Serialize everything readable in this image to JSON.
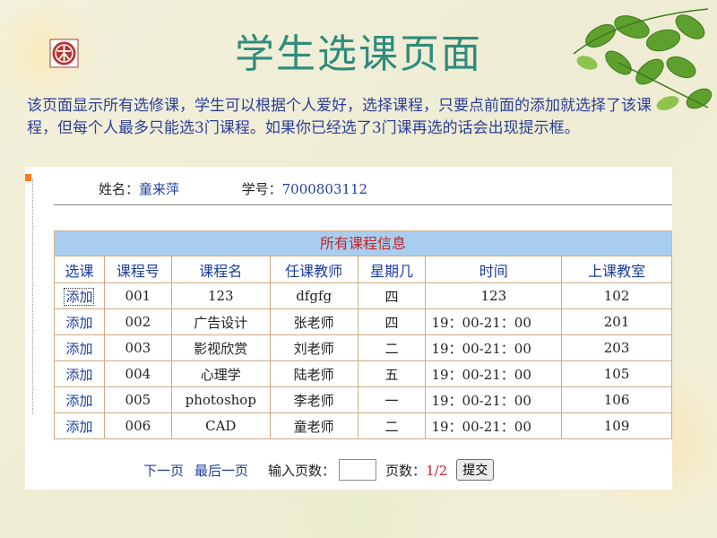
{
  "header": {
    "title": "学生选课页面"
  },
  "description": "该页面显示所有选修课，学生可以根据个人爱好，选择课程，只要点前面的添加就选择了该课程，但每个人最多只能选3门课程。如果你已经选了3门课再选的话会出现提示框。",
  "student": {
    "name_label": "姓名：",
    "name": "童来萍",
    "id_label": "学号：",
    "id": "7000803112"
  },
  "table": {
    "caption": "所有课程信息",
    "columns": [
      "选课",
      "课程号",
      "课程名",
      "任课教师",
      "星期几",
      "时间",
      "上课教室"
    ],
    "rows": [
      {
        "action": "添加",
        "code": "001",
        "name": "123",
        "teacher": "dfgfg",
        "weekday": "四",
        "time": "123",
        "room": "102"
      },
      {
        "action": "添加",
        "code": "002",
        "name": "广告设计",
        "teacher": "张老师",
        "weekday": "四",
        "time": "19：00-21：00",
        "room": "201"
      },
      {
        "action": "添加",
        "code": "003",
        "name": "影视欣赏",
        "teacher": "刘老师",
        "weekday": "二",
        "time": "19：00-21：00",
        "room": "203"
      },
      {
        "action": "添加",
        "code": "004",
        "name": "心理学",
        "teacher": "陆老师",
        "weekday": "五",
        "time": "19：00-21：00",
        "room": "105"
      },
      {
        "action": "添加",
        "code": "005",
        "name": "photoshop",
        "teacher": "李老师",
        "weekday": "一",
        "time": "19：00-21：00",
        "room": "106"
      },
      {
        "action": "添加",
        "code": "006",
        "name": "CAD",
        "teacher": "童老师",
        "weekday": "二",
        "time": "19：00-21：00",
        "room": "109"
      }
    ]
  },
  "pager": {
    "next": "下一页",
    "last": "最后一页",
    "input_label": "输入页数：",
    "input_value": "",
    "pages_label": "页数：",
    "pages_value": "1/2",
    "submit": "提交"
  },
  "colors": {
    "title": "#2f8c7c",
    "link": "#1d3e9e",
    "caption_bg": "#a9cdee",
    "caption_text": "#c0252a"
  }
}
